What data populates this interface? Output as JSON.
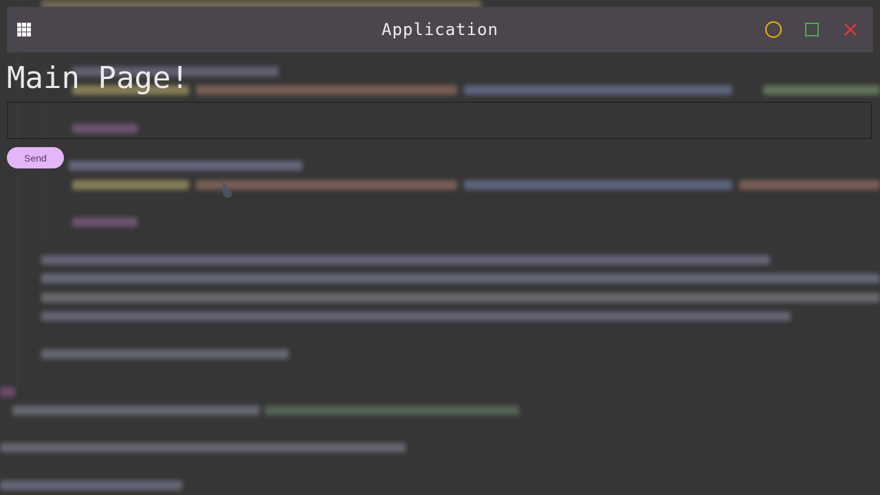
{
  "window": {
    "title": "Application",
    "menu_icon": "apps-grid-icon",
    "minimize_icon": "circle-icon",
    "maximize_icon": "square-icon",
    "close_icon": "close-icon",
    "colors": {
      "titlebar": "#4b454d",
      "minimize": "#f2b400",
      "maximize": "#4caf50",
      "close": "#e53935"
    }
  },
  "main": {
    "heading": "Main Page!",
    "input": {
      "value": "",
      "placeholder": ""
    },
    "send_label": "Send",
    "colors": {
      "send_button": "#e4b5f7",
      "background": "#363636"
    }
  }
}
